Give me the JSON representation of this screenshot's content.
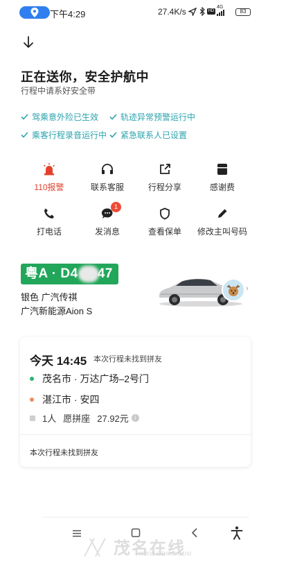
{
  "status_bar": {
    "time": "下午4:29",
    "net_speed": "27.4K/s",
    "battery": "83",
    "signal": "4G"
  },
  "header": {
    "title": "正在送你，安全护航中",
    "subtitle": "行程中请系好安全带"
  },
  "safety_checks": [
    {
      "label": "驾乘意外险已生效"
    },
    {
      "label": "轨迹异常预警运行中"
    },
    {
      "label": "乘客行程录音运行中"
    },
    {
      "label": "紧急联系人已设置"
    }
  ],
  "actions": [
    {
      "label": "110报警",
      "icon": "alarm-light-icon"
    },
    {
      "label": "联系客服",
      "icon": "headset-icon"
    },
    {
      "label": "行程分享",
      "icon": "share-icon"
    },
    {
      "label": "感谢费",
      "icon": "tip-icon"
    },
    {
      "label": "打电话",
      "icon": "phone-icon"
    },
    {
      "label": "发消息",
      "icon": "message-icon",
      "badge": "1"
    },
    {
      "label": "查看保单",
      "icon": "shield-icon"
    },
    {
      "label": "修改主叫号码",
      "icon": "pencil-icon"
    }
  ],
  "vehicle": {
    "plate_prefix": "粤A · D4",
    "plate_suffix": "47",
    "color_brand": "银色  广汽传祺",
    "model": "广汽新能源Aion S"
  },
  "trip": {
    "time": "今天 14:45",
    "note": "本次行程未找到拼友",
    "origin": "茂名市 · 万达广场–2号门",
    "destination": "湛江市 · 安四",
    "passengers": "1人",
    "mode": "愿拼座",
    "price": "27.92元",
    "footer_note": "本次行程未找到拼友"
  },
  "watermark": {
    "text": "茂名在线",
    "url": "WWW.GDMM.COM"
  },
  "colors": {
    "accent_teal": "#2aa3ad",
    "alarm_red": "#e2412d",
    "plate_green": "#21a65a",
    "origin_dot": "#2bb673",
    "destination_dot": "#f08a5d"
  }
}
